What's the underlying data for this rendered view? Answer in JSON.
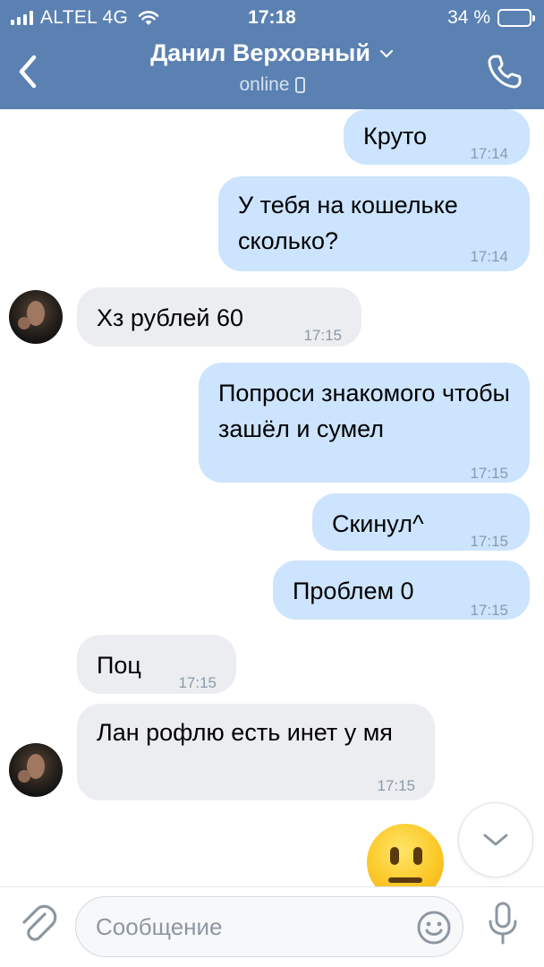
{
  "status_bar": {
    "carrier": "ALTEL 4G",
    "time": "17:18",
    "battery_text": "34 %",
    "battery_level": 0.34
  },
  "header": {
    "contact_name": "Данил Верховный",
    "presence": "online"
  },
  "messages": [
    {
      "direction": "out",
      "text": "Круто",
      "time": "17:14"
    },
    {
      "direction": "out",
      "text": "У тебя на кошельке сколько?",
      "time": "17:14"
    },
    {
      "direction": "in",
      "text": "Хз рублей 60",
      "time": "17:15"
    },
    {
      "direction": "out",
      "text": "Попроси знакомого чтобы зашёл и сумел",
      "time": "17:15"
    },
    {
      "direction": "out",
      "text": "Скинул^",
      "time": "17:15"
    },
    {
      "direction": "out",
      "text": "Проблем 0",
      "time": "17:15"
    },
    {
      "direction": "in",
      "text": "Поц",
      "time": "17:15"
    },
    {
      "direction": "in",
      "text": "Лан рофлю есть инет у мя",
      "time": "17:15"
    }
  ],
  "composer": {
    "placeholder": "Сообщение"
  },
  "colors": {
    "header_bg": "#5a81b1",
    "outgoing_bubble": "#cce4fd",
    "incoming_bubble": "#ebedf0",
    "icon_gray": "#8d97a2"
  }
}
